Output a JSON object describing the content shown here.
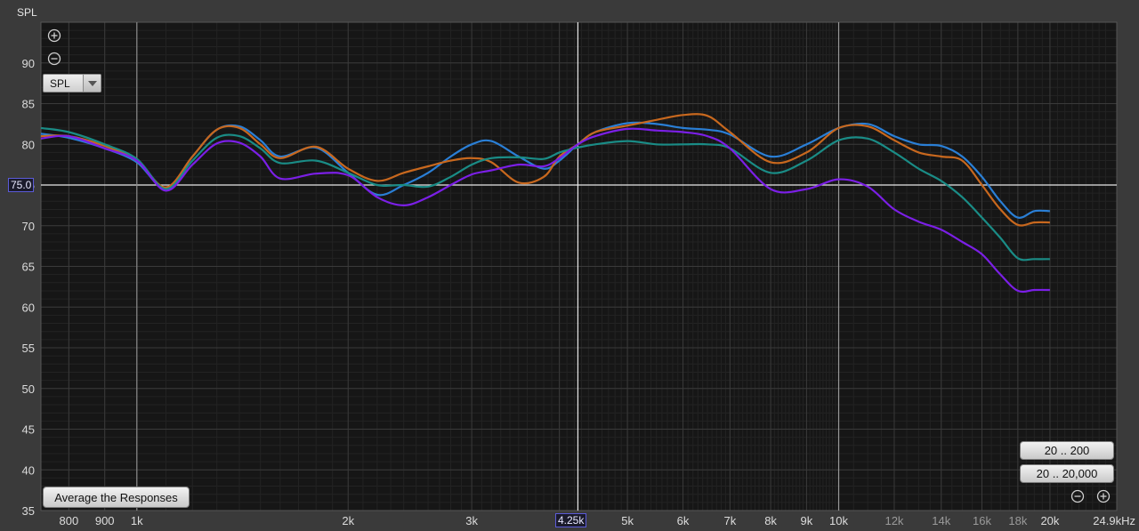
{
  "y_axis_title": "SPL",
  "dropdown": {
    "selected": "SPL"
  },
  "buttons": {
    "average": "Average the Responses",
    "range_low": "20 .. 200",
    "range_full": "20 .. 20,000"
  },
  "cursor": {
    "y_readout": "75.0",
    "x_readout": "4.25k"
  },
  "colors": {
    "background": "#3a3a3a",
    "plot_bg": "#161616",
    "blue": "#2a7fd6",
    "orange": "#c8681e",
    "teal": "#1a8c86",
    "purple": "#7b1fe6"
  },
  "chart_data": {
    "type": "line",
    "x_scale": "log",
    "xlim": [
      730,
      24900
    ],
    "ylim": [
      35,
      95
    ],
    "grid": true,
    "y_ticks": [
      35,
      40,
      45,
      50,
      55,
      60,
      65,
      70,
      75,
      80,
      85,
      90
    ],
    "x_ticks": [
      {
        "v": 800,
        "label": "800",
        "dim": false
      },
      {
        "v": 900,
        "label": "900",
        "dim": false
      },
      {
        "v": 1000,
        "label": "1k",
        "dim": false
      },
      {
        "v": 2000,
        "label": "2k",
        "dim": false
      },
      {
        "v": 3000,
        "label": "3k",
        "dim": false
      },
      {
        "v": 4000,
        "label": "4",
        "dim": false
      },
      {
        "v": 5000,
        "label": "5k",
        "dim": false
      },
      {
        "v": 6000,
        "label": "6k",
        "dim": false
      },
      {
        "v": 7000,
        "label": "7k",
        "dim": false
      },
      {
        "v": 8000,
        "label": "8k",
        "dim": false
      },
      {
        "v": 9000,
        "label": "9k",
        "dim": false
      },
      {
        "v": 10000,
        "label": "10k",
        "dim": false
      },
      {
        "v": 12000,
        "label": "12k",
        "dim": true
      },
      {
        "v": 14000,
        "label": "14k",
        "dim": true
      },
      {
        "v": 16000,
        "label": "16k",
        "dim": true
      },
      {
        "v": 18000,
        "label": "18k",
        "dim": true
      },
      {
        "v": 20000,
        "label": "20k",
        "dim": false
      },
      {
        "v": 24900,
        "label": "24.9kHz",
        "dim": false
      }
    ],
    "x": [
      730,
      800,
      900,
      1000,
      1100,
      1200,
      1300,
      1400,
      1500,
      1600,
      1800,
      2000,
      2200,
      2400,
      2600,
      2800,
      3000,
      3200,
      3500,
      3800,
      4000,
      4250,
      4500,
      5000,
      5500,
      6000,
      6500,
      7000,
      8000,
      9000,
      10000,
      11000,
      12000,
      13000,
      14000,
      15000,
      16000,
      17000,
      18000,
      19000,
      20000
    ],
    "series": [
      {
        "color": "#2a7fd6",
        "values": [
          81.3,
          80.8,
          79.5,
          77.8,
          74.5,
          78.5,
          81.8,
          82.2,
          80.5,
          78.5,
          79.6,
          76.5,
          73.8,
          75.0,
          76.5,
          78.5,
          80.0,
          80.4,
          78.5,
          77.0,
          78.0,
          80.0,
          81.5,
          82.6,
          82.5,
          82.0,
          81.8,
          81.2,
          78.5,
          80.0,
          82.0,
          82.5,
          81.0,
          80.0,
          79.8,
          78.5,
          76.0,
          73.0,
          71.0,
          71.8,
          71.8
        ]
      },
      {
        "color": "#c8681e",
        "values": [
          81.0,
          81.0,
          79.8,
          78.0,
          74.7,
          78.5,
          81.8,
          82.0,
          80.0,
          78.3,
          79.7,
          77.0,
          75.5,
          76.5,
          77.3,
          78.0,
          78.3,
          77.8,
          75.3,
          76.0,
          78.5,
          80.0,
          81.5,
          82.3,
          83.0,
          83.6,
          83.5,
          81.5,
          77.8,
          79.0,
          82.0,
          82.2,
          80.5,
          79.0,
          78.5,
          78.0,
          75.0,
          72.0,
          70.1,
          70.4,
          70.4
        ]
      },
      {
        "color": "#1a8c86",
        "values": [
          82.0,
          81.5,
          80.0,
          78.2,
          74.5,
          78.0,
          80.8,
          81.0,
          79.5,
          77.7,
          78.0,
          76.5,
          75.0,
          75.0,
          74.8,
          76.0,
          77.5,
          78.3,
          78.4,
          78.2,
          79.0,
          79.6,
          80.0,
          80.4,
          80.0,
          80.0,
          80.0,
          79.5,
          76.5,
          78.0,
          80.5,
          80.7,
          79.0,
          77.0,
          75.5,
          73.5,
          71.0,
          68.5,
          66.0,
          65.9,
          65.9
        ]
      },
      {
        "color": "#7b1fe6",
        "values": [
          80.7,
          81.0,
          79.5,
          78.0,
          74.3,
          77.5,
          80.1,
          80.2,
          78.5,
          75.8,
          76.4,
          76.2,
          73.5,
          72.5,
          73.5,
          75.0,
          76.3,
          76.8,
          77.5,
          77.3,
          78.3,
          80.0,
          81.0,
          81.9,
          81.7,
          81.5,
          81.0,
          79.5,
          74.5,
          74.5,
          75.7,
          74.8,
          72.0,
          70.5,
          69.5,
          68.0,
          66.5,
          64.0,
          62.0,
          62.1,
          62.1
        ]
      }
    ]
  }
}
